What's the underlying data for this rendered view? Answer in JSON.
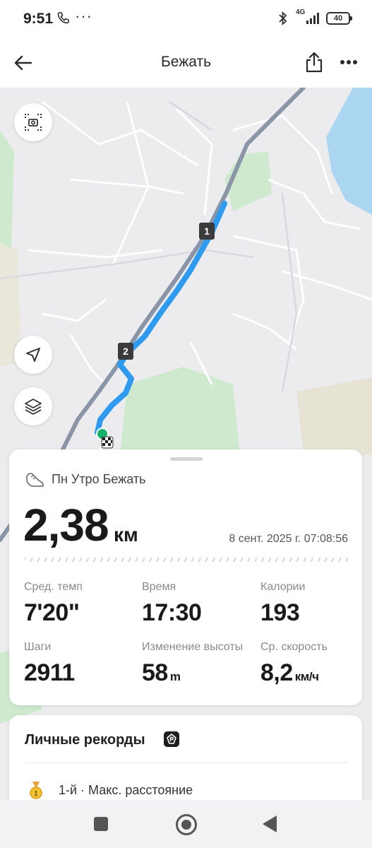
{
  "status_bar": {
    "time": "9:51",
    "dots": "···",
    "network": "4G",
    "battery": "40"
  },
  "header": {
    "title": "Бежать",
    "back_icon": "arrow-left-icon",
    "share_icon": "share-icon",
    "more_icon": "more-horizontal-icon"
  },
  "map": {
    "controls": [
      "screenshot-icon",
      "location-arrow-icon",
      "layers-icon"
    ],
    "markers": [
      "1",
      "2"
    ],
    "route_color": "#2e9bf0"
  },
  "activity": {
    "title": "Пн Утро Бежать",
    "distance": "2,38",
    "distance_unit": "км",
    "datetime": "8 сент. 2025 г. 07:08:56",
    "stats": [
      {
        "label": "Сред. темп",
        "value": "7'20\"",
        "unit": ""
      },
      {
        "label": "Время",
        "value": "17:30",
        "unit": ""
      },
      {
        "label": "Калории",
        "value": "193",
        "unit": ""
      },
      {
        "label": "Шаги",
        "value": "2911",
        "unit": ""
      },
      {
        "label": "Изменение высоты",
        "value": "58",
        "unit": "m"
      },
      {
        "label": "Ср. скорость",
        "value": "8,2",
        "unit": "км/ч"
      }
    ]
  },
  "records": {
    "title": "Личные рекорды",
    "items": [
      {
        "medal": "1",
        "text": "1-й · Макс. расстояние"
      }
    ]
  },
  "colors": {
    "accent": "#2e9bf0",
    "park": "#cfe9cf",
    "water": "#aad6f2"
  }
}
